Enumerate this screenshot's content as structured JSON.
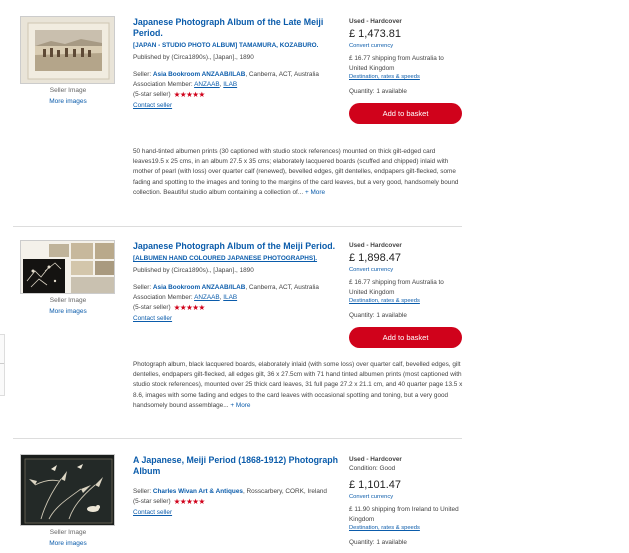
{
  "listings": [
    {
      "title": "Japanese Photograph Album of the Late Meiji Period.",
      "subtitle": "[JAPAN - STUDIO PHOTO ALBUM] TAMAMURA, KOZABURO.",
      "published": "Published by (Circa1890s)., [Japan]., 1890",
      "seller_prefix": "Seller:",
      "seller_name": "Asia Bookroom ANZAAB/ILAB",
      "seller_location": ", Canberra, ACT, Australia",
      "assoc_label": "Association Member:",
      "assoc_1": "ANZAAB",
      "assoc_2": "ILAB",
      "rating_text": "(5-star seller)",
      "stars": "★★★★★",
      "contact": "Contact seller",
      "seller_image": "Seller Image",
      "more_images": "More images",
      "description": "50 hand-tinted albumen prints (30 captioned with studio stock references) mounted on thick gilt-edged card leaves19.5 x 25 cms, in an album 27.5 x 35 cms; elaborately lacquered boards (scuffed and chipped) inlaid with mother of pearl (with loss) over quarter calf (renewed), bevelled edges, gilt dentelles, endpapers gilt-flecked, some fading and spotting to the images and toning to the margins of the card leaves, but a very good, handsomely bound collection. Beautiful studio album containing a collection of...",
      "more": "+ More",
      "condition": "Used - Hardcover",
      "condition_detail": "",
      "price": "£ 1,473.81",
      "convert": "Convert currency",
      "shipping": "£ 16.77 shipping from Australia to United Kingdom",
      "destination": "Destination, rates & speeds",
      "quantity": "Quantity: 1 available",
      "basket": "Add to basket"
    },
    {
      "title": "Japanese Photograph Album of the Meiji Period.",
      "subtitle": "[ALBUMEN HAND COLOURED JAPANESE PHOTOGRAPHS].",
      "published": "Published by (Circa1890s)., [Japan]., 1890",
      "seller_prefix": "Seller:",
      "seller_name": "Asia Bookroom ANZAAB/ILAB",
      "seller_location": ", Canberra, ACT, Australia",
      "assoc_label": "Association Member:",
      "assoc_1": "ANZAAB",
      "assoc_2": "ILAB",
      "rating_text": "(5-star seller)",
      "stars": "★★★★★",
      "contact": "Contact seller",
      "seller_image": "Seller Image",
      "more_images": "More images",
      "description": "Photograph album, black lacquered boards, elaborately inlaid (with some loss) over quarter calf, bevelled edges, gilt dentelles, endpapers gilt-flecked, all edges gilt, 36 x 27.5cm with 71 hand tinted albumen prints (most captioned with studio stock references), mounted over 25 thick card leaves, 31 full page 27.2 x 21.1 cm, and 40 quarter page 13.5 x 8.6, images with some fading and edges to the card leaves with occasional spotting and toning, but a very good handsomely bound assemblage...",
      "more": "+ More",
      "condition": "Used - Hardcover",
      "condition_detail": "",
      "price": "£ 1,898.47",
      "convert": "Convert currency",
      "shipping": "£ 16.77 shipping from Australia to United Kingdom",
      "destination": "Destination, rates & speeds",
      "quantity": "Quantity: 1 available",
      "basket": "Add to basket"
    },
    {
      "title": "A Japanese, Meiji Period (1868-1912) Photograph Album",
      "subtitle": "",
      "published": "",
      "seller_prefix": "Seller:",
      "seller_name": "Charles Wivan Art & Antiques",
      "seller_location": ", Rosscarbery, CORK, Ireland",
      "rating_text": "(5-star seller)",
      "stars": "★★★★★",
      "contact": "Contact seller",
      "seller_image": "Seller Image",
      "more_images": "More images",
      "condition": "Used - Hardcover",
      "condition_detail": "Condition: Good",
      "price": "£ 1,101.47",
      "convert": "Convert currency",
      "shipping": "£ 11.90 shipping from Ireland to United Kingdom",
      "destination": "Destination, rates & speeds",
      "quantity": "Quantity: 1 available"
    }
  ],
  "colors": {
    "link": "#0b5cab",
    "basket": "#d0021b",
    "stars": "#d0021b"
  }
}
